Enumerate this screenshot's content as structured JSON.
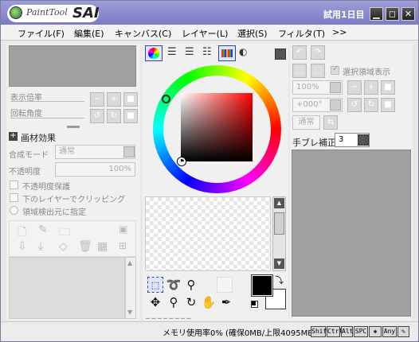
{
  "app": {
    "logo_text": "PaintTool",
    "logo_sai": "SAI",
    "trial": "試用1日目"
  },
  "window_buttons": [
    "minimize",
    "maximize",
    "close"
  ],
  "menu": [
    "ファイル(F)",
    "編集(E)",
    "キャンバス(C)",
    "レイヤー(L)",
    "選択(S)",
    "フィルタ(T)",
    ">>"
  ],
  "left": {
    "zoom_label": "表示倍率",
    "angle_label": "回転角度",
    "paint_effect": "画材効果",
    "blend_mode_label": "合成モード",
    "blend_mode_value": "通常",
    "opacity_label": "不透明度",
    "opacity_value": "100%",
    "protect_opacity": "不透明度保護",
    "clip_lower": "下のレイヤーでクリッピング",
    "detect_source": "領域検出元に指定"
  },
  "right": {
    "show_selection": "選択領域表示",
    "zoom_value": "100%",
    "angle_value": "+000°",
    "mode_value": "通常",
    "stabilizer_label": "手ブレ補正",
    "stabilizer_value": "3"
  },
  "status": {
    "memory": "メモリ使用率0% (確保0MB/上限4095MB)",
    "keys": [
      "Shift",
      "Ctrl",
      "Alt",
      "SPC",
      "◈",
      "Any",
      "✎"
    ]
  },
  "colors": {
    "title_top": "#9d9dd8",
    "title_bottom": "#7b7bc4",
    "primary": "#000000",
    "secondary": "#ffffff"
  }
}
